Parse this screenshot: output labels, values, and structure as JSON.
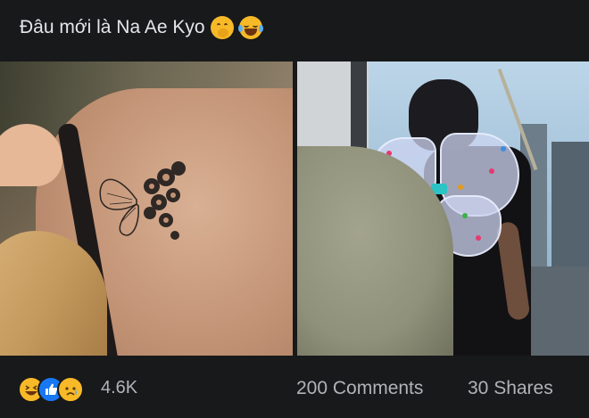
{
  "post": {
    "caption": "Đâu mới là Na Ae Kyo",
    "caption_emojis": [
      "shushing-face-icon",
      "face-with-tears-of-joy-icon"
    ]
  },
  "photos": [
    {
      "name": "back-tattoo-photo"
    },
    {
      "name": "fairy-wings-photo"
    }
  ],
  "footer": {
    "reaction_icons": [
      "haha-reaction-icon",
      "like-reaction-icon",
      "sad-reaction-icon"
    ],
    "reaction_count": "4.6K",
    "comments_label": "200 Comments",
    "shares_label": "30 Shares"
  },
  "colors": {
    "background": "#18191a",
    "text_primary": "#e4e6eb",
    "text_secondary": "#b0b3b8",
    "like_blue": "#1877f2",
    "emoji_yellow": "#f7b928"
  }
}
